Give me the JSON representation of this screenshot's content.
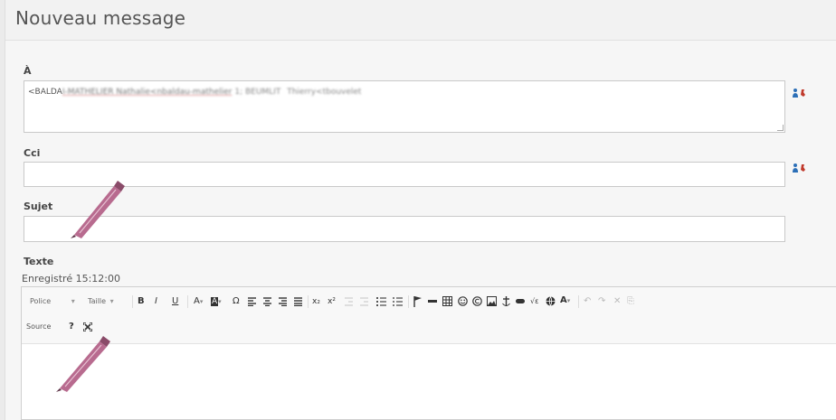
{
  "app": {
    "title": "Nouveau message"
  },
  "to": {
    "label": "À",
    "value_visible": "<BALDA",
    "value_obscured_1": "I-MATHELIER Nathalie<nbaldau-mathelier",
    "value_obscured_2": "1; BEUMLIT",
    "value_obscured_3": "Thierry<tbouvelet"
  },
  "cci": {
    "label": "Cci",
    "value": ""
  },
  "subject": {
    "label": "Sujet",
    "value": ""
  },
  "body": {
    "label": "Texte",
    "saved_status": "Enregistré 15:12:00"
  },
  "toolbar": {
    "font_label": "Police",
    "size_label": "Taille",
    "bold": "B",
    "italic": "I",
    "underline": "U",
    "text_color": "A",
    "bg_color": "A",
    "special_char": "Ω",
    "subscript": "x₂",
    "superscript": "x²",
    "source_label": "Source",
    "help": "?",
    "maximize": "⤧"
  },
  "colors": {
    "accent_red": "#c0392b",
    "accent_blue": "#2c6fb7",
    "pen": "#b86b8f"
  }
}
